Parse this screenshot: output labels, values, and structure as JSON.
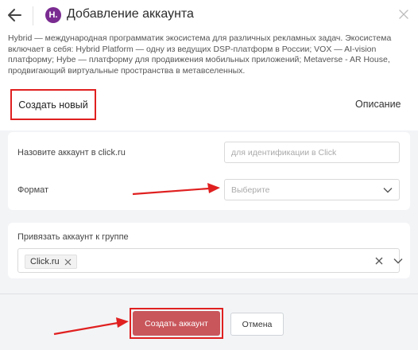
{
  "header": {
    "title": "Добавление аккаунта",
    "logo_text": "H."
  },
  "description": "Hybrid — международная программатик экосистема для различных рекламных задач. Экосистема включает в себя: Hybrid Platform — одну из ведущих DSP-платформ в России; VOX — AI-vision платформу; Hybe — платформу для продвижения мобильных приложений; Metaverse - AR House, продвигающий виртуальные пространства в метавселенных.",
  "tabs": {
    "new": "Создать новый",
    "description": "Описание"
  },
  "form": {
    "account_name_label": "Назовите аккаунт в click.ru",
    "account_name_placeholder": "для идентификации в Click",
    "format_label": "Формат",
    "format_placeholder": "Выберите",
    "group_label": "Привязать аккаунт к группе",
    "group_tag": "Click.ru"
  },
  "footer": {
    "create_label": "Создать аккаунт",
    "cancel_label": "Отмена"
  },
  "colors": {
    "accent": "#c8565b",
    "annotation_red": "#e02020",
    "logo": "#7a2b91"
  }
}
